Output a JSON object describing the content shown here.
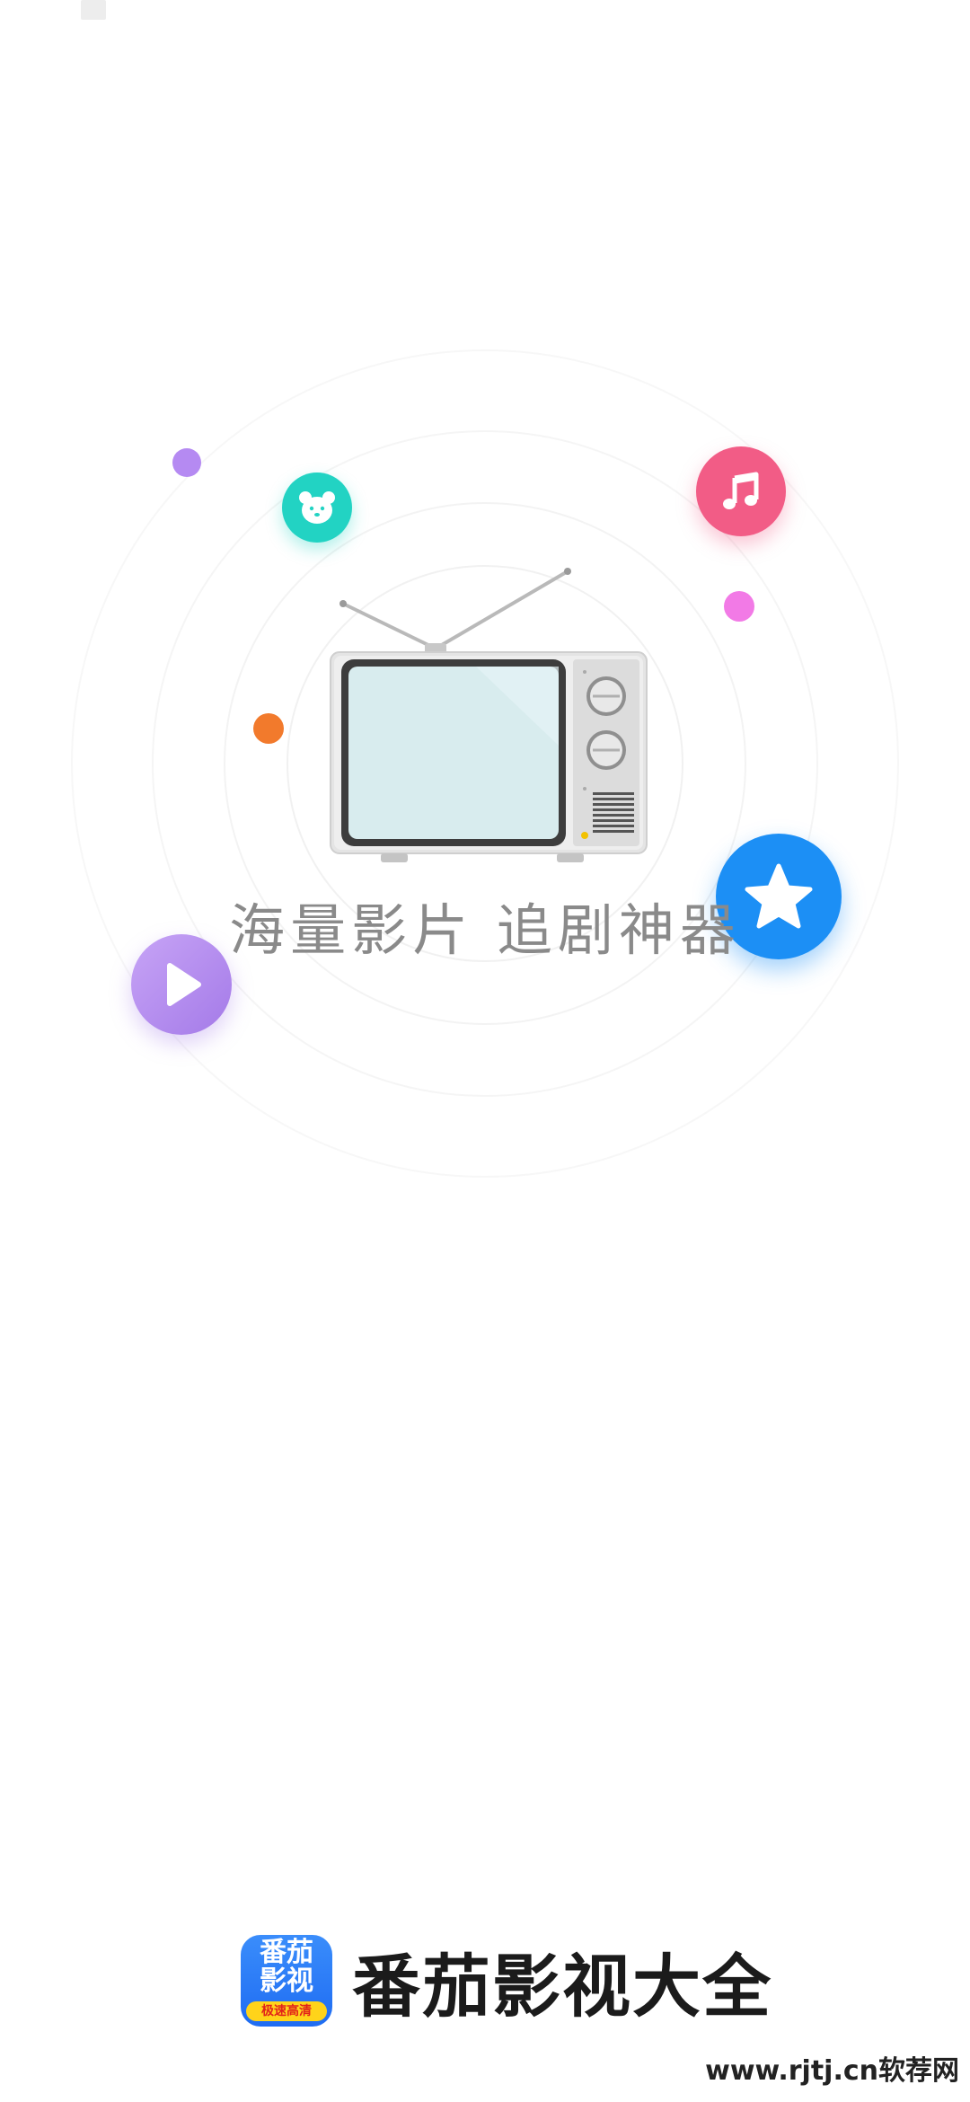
{
  "splash": {
    "slogan": "海量影片 追剧神器"
  },
  "brand": {
    "icon_line1": "番茄",
    "icon_line2": "影视",
    "icon_tag": "极速高清",
    "name": "番茄影视大全"
  },
  "watermark": "www.rjtj.cn软荐网",
  "icons": [
    "bear-icon",
    "music-note-icon",
    "star-icon",
    "play-icon",
    "tv-illustration"
  ],
  "colors": {
    "bear_bubble": "#22d3c3",
    "music_bubble": "#f25c86",
    "star_bubble": "#1c8ff5",
    "play_bubble": "#b48cf0",
    "purple_dot": "#b58af2",
    "pink_dot": "#f27ae6",
    "orange_dot": "#f27a2c",
    "brand_blue": "#2a7cf8"
  }
}
